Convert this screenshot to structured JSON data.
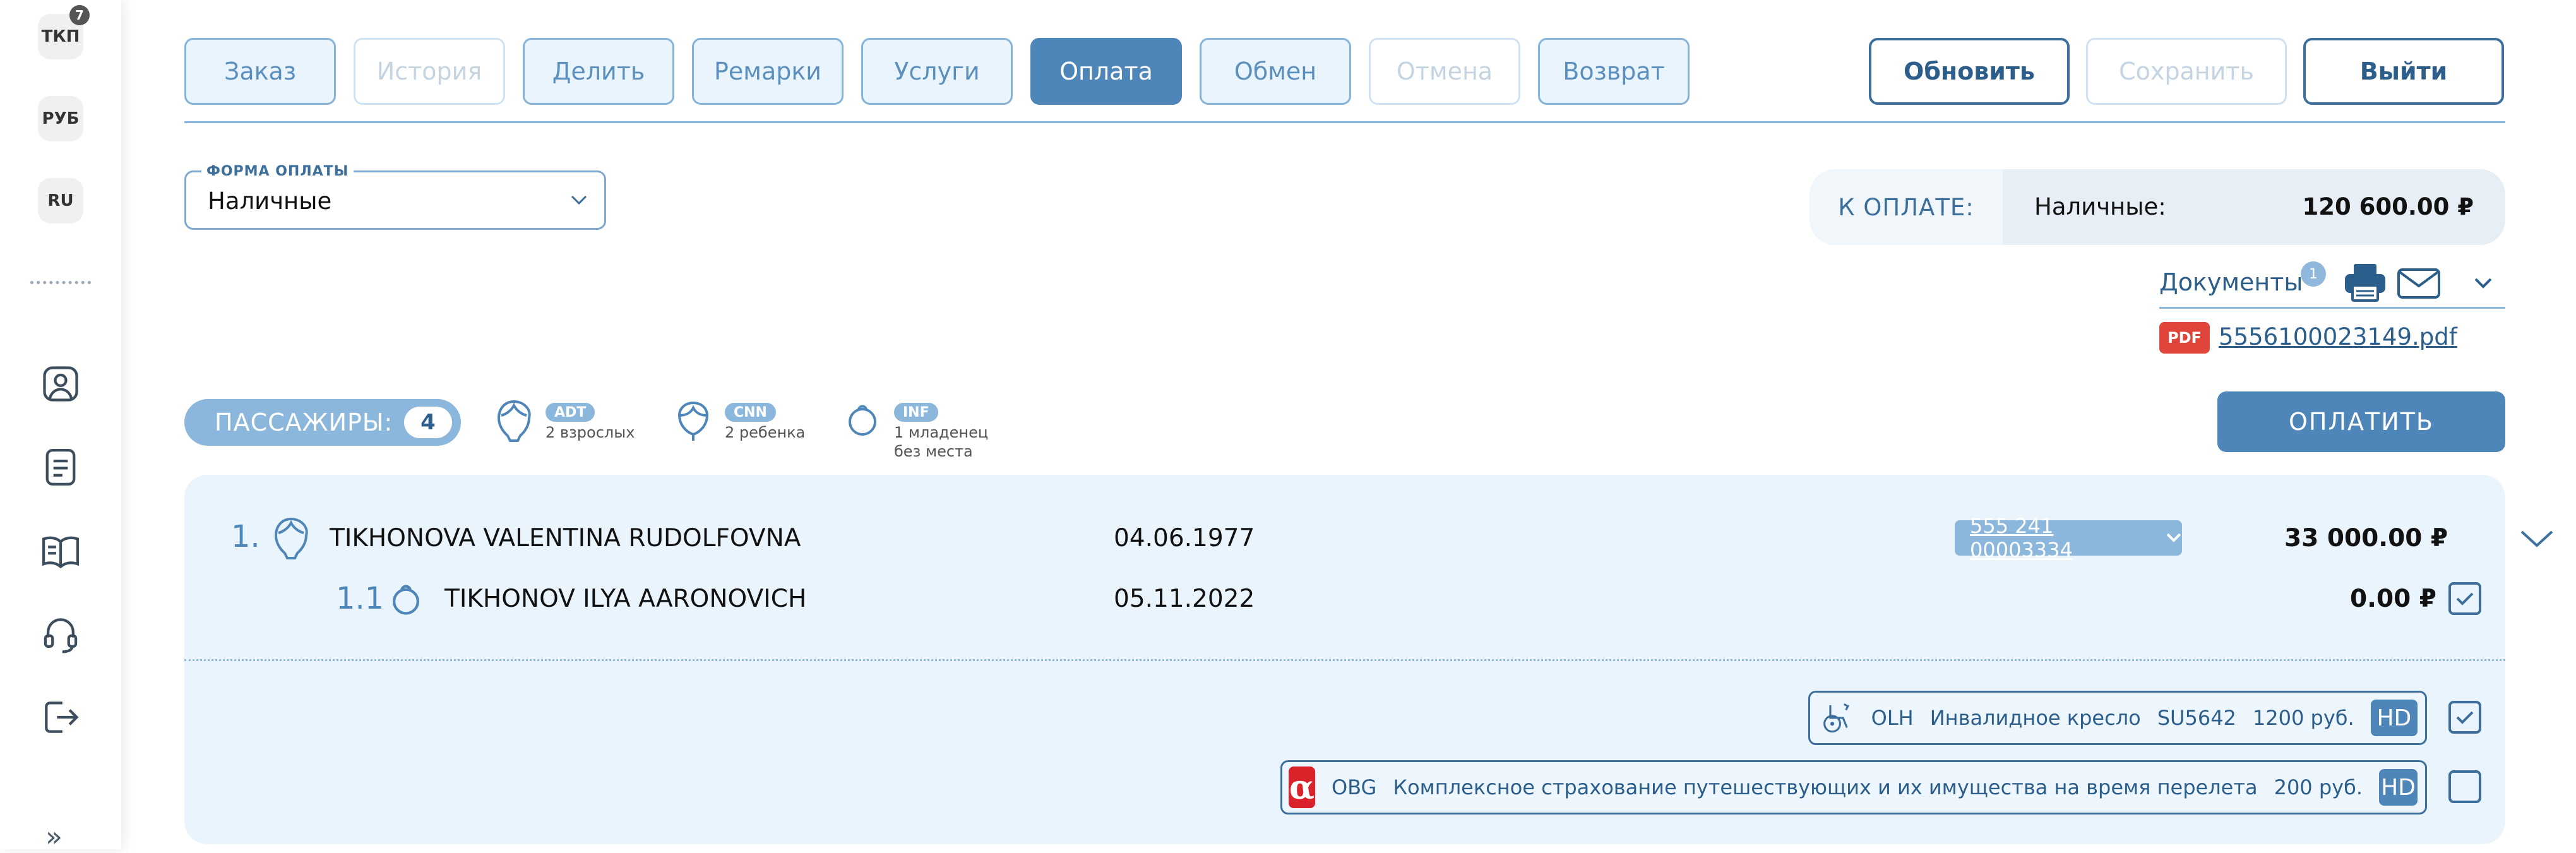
{
  "sidebar": {
    "items": [
      {
        "label": "ТКП",
        "badge": "7"
      },
      {
        "label": "РУБ"
      },
      {
        "label": "RU"
      }
    ],
    "nav_icons": [
      "profile-icon",
      "notebook-icon",
      "book-icon",
      "headset-icon",
      "logout-icon"
    ],
    "expand": "»"
  },
  "tabs": [
    {
      "label": "Заказ",
      "state": "normal"
    },
    {
      "label": "История",
      "state": "disabled"
    },
    {
      "label": "Делить",
      "state": "normal"
    },
    {
      "label": "Ремарки",
      "state": "normal"
    },
    {
      "label": "Услуги",
      "state": "normal"
    },
    {
      "label": "Оплата",
      "state": "active"
    },
    {
      "label": "Обмен",
      "state": "normal"
    },
    {
      "label": "Отмена",
      "state": "disabled"
    },
    {
      "label": "Возврат",
      "state": "normal"
    }
  ],
  "actions": {
    "refresh": "Обновить",
    "save": "Сохранить",
    "exit": "Выйти"
  },
  "payment_form": {
    "legend": "ФОРМА ОПЛАТЫ",
    "value": "Наличные"
  },
  "to_pay": {
    "label": "К ОПЛАТЕ:",
    "method": "Наличные:",
    "amount": "120 600.00 ₽"
  },
  "documents": {
    "label": "Документы",
    "count": "1",
    "file_badge": "PDF",
    "file_name": "5556100023149.pdf"
  },
  "passengers": {
    "label": "ПАССАЖИРЫ:",
    "count": "4",
    "types": [
      {
        "code": "ADT",
        "desc": "2 взрослых"
      },
      {
        "code": "CNN",
        "desc": "2 ребенка"
      },
      {
        "code": "INF",
        "desc": "1 младенец",
        "desc2": "без места"
      }
    ]
  },
  "pay_button": "ОПЛАТИТЬ",
  "rows": [
    {
      "num": "1.",
      "name": "TIKHONOVA VALENTINA RUDOLFOVNA",
      "dob": "04.06.1977",
      "ticket": "555 241 00003334",
      "price": "33 000.00 ₽"
    },
    {
      "num": "1.1",
      "name": "TIKHONOV ILYA AARONOVICH",
      "dob": "05.11.2022",
      "price": "0.00 ₽",
      "checked": true
    }
  ],
  "services": [
    {
      "code": "OLH",
      "name": "Инвалидное кресло",
      "flight": "SU5642",
      "price": "1200 руб.",
      "status": "HD",
      "checked": true
    },
    {
      "logo": "α",
      "code": "OBG",
      "name": "Комплексное страхование путешествующих и их имущества на время перелета",
      "price": "200 руб.",
      "status": "HD",
      "checked": false
    }
  ],
  "colors": {
    "accent": "#4f86b9",
    "accent_light": "#8cb7dc",
    "card_bg": "#e9f4fc",
    "pdf_red": "#e0453b",
    "alpha_red": "#d9222a"
  }
}
